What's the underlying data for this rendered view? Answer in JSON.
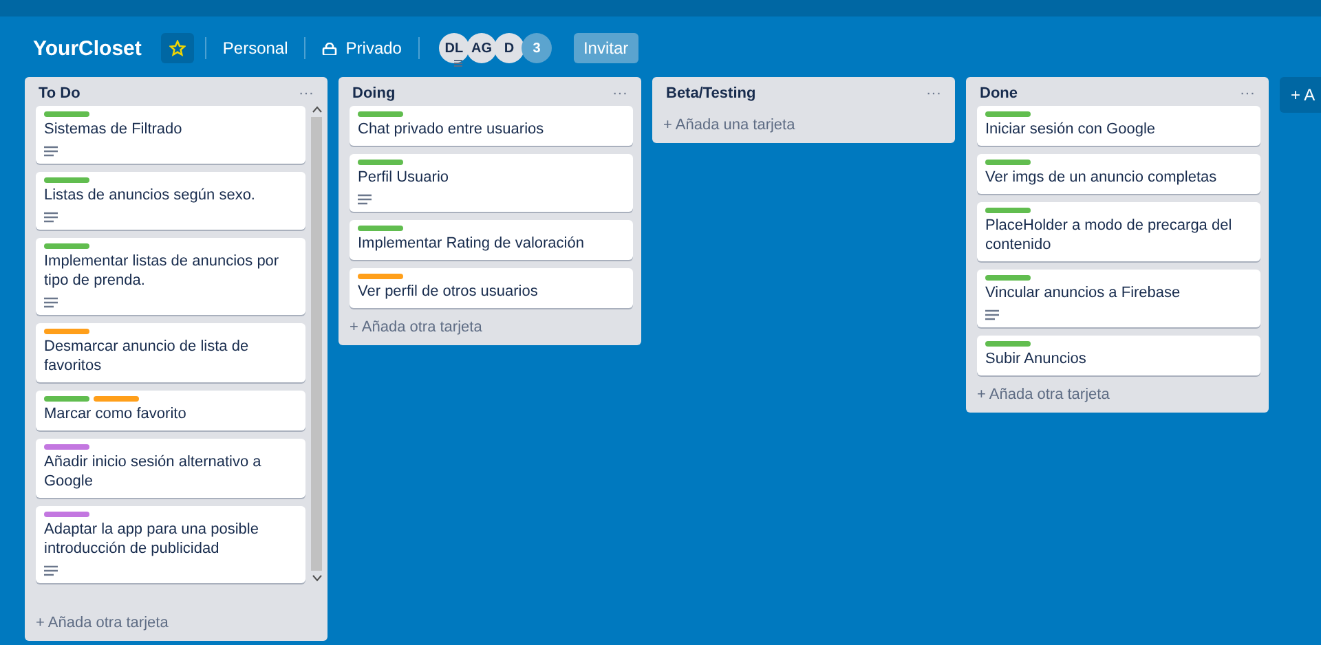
{
  "board": {
    "title": "YourCloset",
    "starred": true,
    "team": "Personal",
    "visibility": "Privado",
    "members": [
      "DL",
      "AG",
      "D"
    ],
    "member_count": "3",
    "invite": "Invitar"
  },
  "lists": [
    {
      "title": "To Do",
      "menu": "···",
      "add": "+ Añada otra tarjeta",
      "scrollable": true,
      "cards": [
        {
          "title": "Sistemas de Filtrado",
          "labels": [
            {
              "color": "#61bd4f"
            }
          ],
          "has_description": true
        },
        {
          "title": "Listas de anuncios según sexo.",
          "labels": [
            {
              "color": "#61bd4f"
            }
          ],
          "has_description": true
        },
        {
          "title": "Implementar listas de anuncios por tipo de prenda.",
          "labels": [
            {
              "color": "#61bd4f"
            }
          ],
          "has_description": true
        },
        {
          "title": "Desmarcar anuncio de lista de favoritos",
          "labels": [
            {
              "color": "#ff9f1a"
            }
          ],
          "has_description": false
        },
        {
          "title": "Marcar como favorito",
          "labels": [
            {
              "color": "#61bd4f"
            },
            {
              "color": "#ff9f1a"
            }
          ],
          "has_description": false
        },
        {
          "title": "Añadir inicio sesión alternativo a Google",
          "labels": [
            {
              "color": "#c377e0"
            }
          ],
          "has_description": false
        },
        {
          "title": "Adaptar la app para una posible introducción de publicidad",
          "labels": [
            {
              "color": "#c377e0"
            }
          ],
          "has_description": true
        }
      ]
    },
    {
      "title": "Doing",
      "menu": "···",
      "add": "+ Añada otra tarjeta",
      "scrollable": false,
      "cards": [
        {
          "title": "Chat privado entre usuarios",
          "labels": [
            {
              "color": "#61bd4f"
            }
          ],
          "has_description": false
        },
        {
          "title": "Perfil Usuario",
          "labels": [
            {
              "color": "#61bd4f"
            }
          ],
          "has_description": true
        },
        {
          "title": "Implementar Rating de valoración",
          "labels": [
            {
              "color": "#61bd4f"
            }
          ],
          "has_description": false
        },
        {
          "title": "Ver perfil de otros usuarios",
          "labels": [
            {
              "color": "#ff9f1a"
            }
          ],
          "has_description": false
        }
      ]
    },
    {
      "title": "Beta/Testing",
      "menu": "···",
      "add": "+ Añada una tarjeta",
      "scrollable": false
    },
    {
      "title": "Done",
      "menu": "···",
      "add": "+ Añada otra tarjeta",
      "scrollable": false,
      "cards": [
        {
          "title": "Iniciar sesión con Google",
          "labels": [
            {
              "color": "#61bd4f"
            }
          ],
          "has_description": false
        },
        {
          "title": "Ver imgs de un anuncio completas",
          "labels": [
            {
              "color": "#61bd4f"
            }
          ],
          "has_description": false
        },
        {
          "title": "PlaceHolder a modo de precarga del contenido",
          "labels": [
            {
              "color": "#61bd4f"
            }
          ],
          "has_description": false
        },
        {
          "title": "Vincular anuncios a Firebase",
          "labels": [
            {
              "color": "#61bd4f"
            }
          ],
          "has_description": true
        },
        {
          "title": "Subir Anuncios",
          "labels": [
            {
              "color": "#61bd4f"
            }
          ],
          "has_description": false
        }
      ]
    }
  ],
  "add_list": "+ A"
}
